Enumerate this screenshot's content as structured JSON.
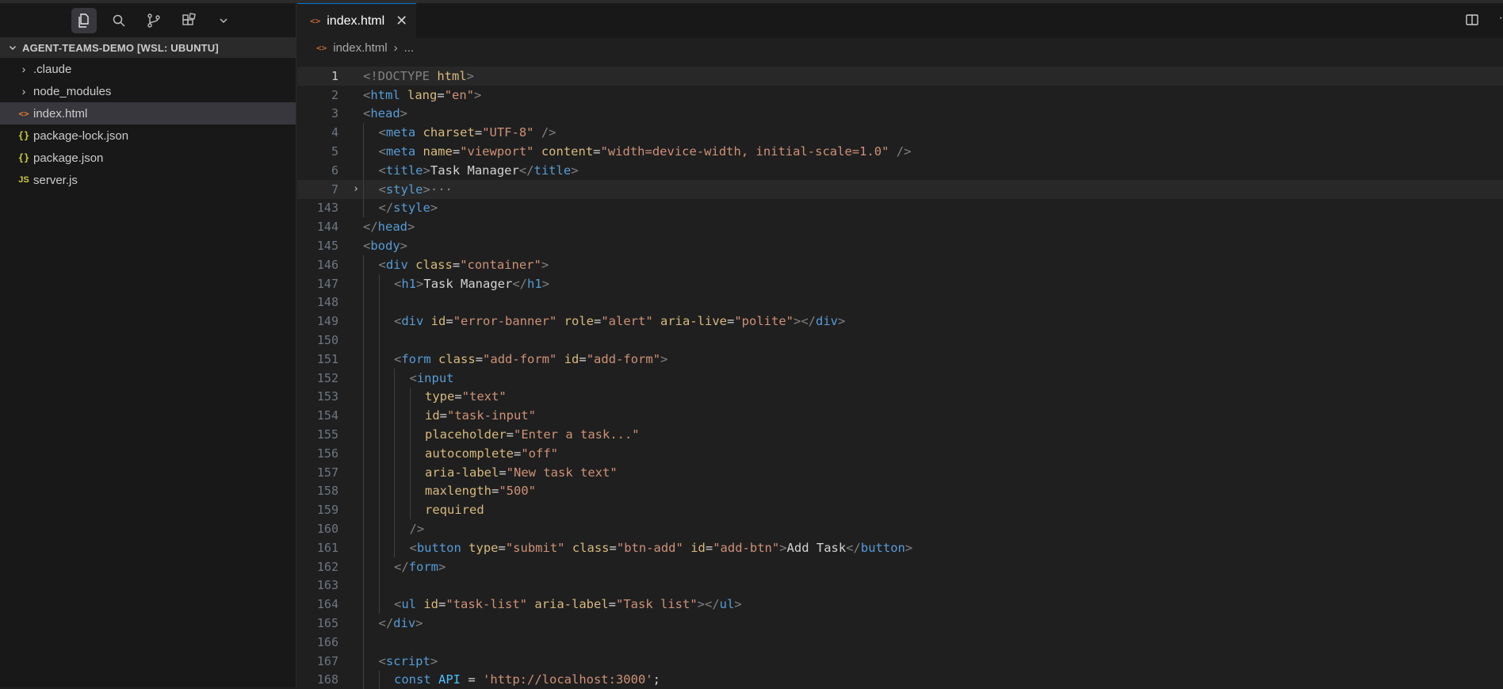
{
  "sidebar": {
    "project_title": "AGENT-TEAMS-DEMO [WSL: UBUNTU]",
    "items": [
      {
        "label": ".claude",
        "icon": "chevron-right-icon"
      },
      {
        "label": "node_modules",
        "icon": "chevron-right-icon"
      },
      {
        "label": "index.html",
        "icon": "<>"
      },
      {
        "label": "package-lock.json",
        "icon": "{}"
      },
      {
        "label": "package.json",
        "icon": "{}"
      },
      {
        "label": "server.js",
        "icon": "JS"
      }
    ]
  },
  "editor": {
    "tab_label": "index.html",
    "tab_icon": "<>",
    "breadcrumb_file": "index.html",
    "breadcrumb_more": "..."
  },
  "lines": [
    {
      "n": "1",
      "indent": 0,
      "fold": "",
      "tokens": [
        [
          "tag",
          "<!DOCTYPE "
        ],
        [
          "attr2",
          "html"
        ],
        [
          "tag",
          ">"
        ]
      ]
    },
    {
      "n": "2",
      "indent": 0,
      "fold": "",
      "tokens": [
        [
          "tag",
          "<"
        ],
        [
          "name",
          "html "
        ],
        [
          "attr2",
          "lang"
        ],
        [
          "text",
          "="
        ],
        [
          "str",
          "\"en\""
        ],
        [
          "tag",
          ">"
        ]
      ]
    },
    {
      "n": "3",
      "indent": 0,
      "fold": "",
      "tokens": [
        [
          "tag",
          "<"
        ],
        [
          "name",
          "head"
        ],
        [
          "tag",
          ">"
        ]
      ]
    },
    {
      "n": "4",
      "indent": 1,
      "fold": "",
      "tokens": [
        [
          "tag",
          "<"
        ],
        [
          "name",
          "meta "
        ],
        [
          "attr2",
          "charset"
        ],
        [
          "text",
          "="
        ],
        [
          "str",
          "\"UTF-8\""
        ],
        [
          "tag",
          " />"
        ]
      ]
    },
    {
      "n": "5",
      "indent": 1,
      "fold": "",
      "tokens": [
        [
          "tag",
          "<"
        ],
        [
          "name",
          "meta "
        ],
        [
          "attr2",
          "name"
        ],
        [
          "text",
          "="
        ],
        [
          "str",
          "\"viewport\" "
        ],
        [
          "attr2",
          "content"
        ],
        [
          "text",
          "="
        ],
        [
          "str",
          "\"width=device-width, initial-scale=1.0\""
        ],
        [
          "tag",
          " />"
        ]
      ]
    },
    {
      "n": "6",
      "indent": 1,
      "fold": "",
      "tokens": [
        [
          "tag",
          "<"
        ],
        [
          "name",
          "title"
        ],
        [
          "tag",
          ">"
        ],
        [
          "text",
          "Task Manager"
        ],
        [
          "tag",
          "</"
        ],
        [
          "name",
          "title"
        ],
        [
          "tag",
          ">"
        ]
      ]
    },
    {
      "n": "7",
      "indent": 1,
      "fold": "›",
      "tokens": [
        [
          "tag",
          "<"
        ],
        [
          "name",
          "style"
        ],
        [
          "tag",
          ">"
        ],
        [
          "dim",
          "···"
        ]
      ]
    },
    {
      "n": "143",
      "indent": 1,
      "fold": "",
      "tokens": [
        [
          "tag",
          "</"
        ],
        [
          "name",
          "style"
        ],
        [
          "tag",
          ">"
        ]
      ]
    },
    {
      "n": "144",
      "indent": 0,
      "fold": "",
      "tokens": [
        [
          "tag",
          "</"
        ],
        [
          "name",
          "head"
        ],
        [
          "tag",
          ">"
        ]
      ]
    },
    {
      "n": "145",
      "indent": 0,
      "fold": "",
      "tokens": [
        [
          "tag",
          "<"
        ],
        [
          "name",
          "body"
        ],
        [
          "tag",
          ">"
        ]
      ]
    },
    {
      "n": "146",
      "indent": 1,
      "fold": "",
      "tokens": [
        [
          "tag",
          "<"
        ],
        [
          "name",
          "div "
        ],
        [
          "attr2",
          "class"
        ],
        [
          "text",
          "="
        ],
        [
          "str",
          "\"container\""
        ],
        [
          "tag",
          ">"
        ]
      ]
    },
    {
      "n": "147",
      "indent": 2,
      "fold": "",
      "tokens": [
        [
          "tag",
          "<"
        ],
        [
          "name",
          "h1"
        ],
        [
          "tag",
          ">"
        ],
        [
          "text",
          "Task Manager"
        ],
        [
          "tag",
          "</"
        ],
        [
          "name",
          "h1"
        ],
        [
          "tag",
          ">"
        ]
      ]
    },
    {
      "n": "148",
      "indent": 2,
      "fold": "",
      "tokens": []
    },
    {
      "n": "149",
      "indent": 2,
      "fold": "",
      "tokens": [
        [
          "tag",
          "<"
        ],
        [
          "name",
          "div "
        ],
        [
          "attr2",
          "id"
        ],
        [
          "text",
          "="
        ],
        [
          "str",
          "\"error-banner\" "
        ],
        [
          "attr2",
          "role"
        ],
        [
          "text",
          "="
        ],
        [
          "str",
          "\"alert\" "
        ],
        [
          "attr2",
          "aria-live"
        ],
        [
          "text",
          "="
        ],
        [
          "str",
          "\"polite\""
        ],
        [
          "tag",
          "></"
        ],
        [
          "name",
          "div"
        ],
        [
          "tag",
          ">"
        ]
      ]
    },
    {
      "n": "150",
      "indent": 2,
      "fold": "",
      "tokens": []
    },
    {
      "n": "151",
      "indent": 2,
      "fold": "",
      "tokens": [
        [
          "tag",
          "<"
        ],
        [
          "name",
          "form "
        ],
        [
          "attr2",
          "class"
        ],
        [
          "text",
          "="
        ],
        [
          "str",
          "\"add-form\" "
        ],
        [
          "attr2",
          "id"
        ],
        [
          "text",
          "="
        ],
        [
          "str",
          "\"add-form\""
        ],
        [
          "tag",
          ">"
        ]
      ]
    },
    {
      "n": "152",
      "indent": 3,
      "fold": "",
      "tokens": [
        [
          "tag",
          "<"
        ],
        [
          "name",
          "input"
        ]
      ]
    },
    {
      "n": "153",
      "indent": 4,
      "fold": "",
      "tokens": [
        [
          "attr2",
          "type"
        ],
        [
          "text",
          "="
        ],
        [
          "str",
          "\"text\""
        ]
      ]
    },
    {
      "n": "154",
      "indent": 4,
      "fold": "",
      "tokens": [
        [
          "attr2",
          "id"
        ],
        [
          "text",
          "="
        ],
        [
          "str",
          "\"task-input\""
        ]
      ]
    },
    {
      "n": "155",
      "indent": 4,
      "fold": "",
      "tokens": [
        [
          "attr2",
          "placeholder"
        ],
        [
          "text",
          "="
        ],
        [
          "str",
          "\"Enter a task...\""
        ]
      ]
    },
    {
      "n": "156",
      "indent": 4,
      "fold": "",
      "tokens": [
        [
          "attr2",
          "autocomplete"
        ],
        [
          "text",
          "="
        ],
        [
          "str",
          "\"off\""
        ]
      ]
    },
    {
      "n": "157",
      "indent": 4,
      "fold": "",
      "tokens": [
        [
          "attr2",
          "aria-label"
        ],
        [
          "text",
          "="
        ],
        [
          "str",
          "\"New task text\""
        ]
      ]
    },
    {
      "n": "158",
      "indent": 4,
      "fold": "",
      "tokens": [
        [
          "attr2",
          "maxlength"
        ],
        [
          "text",
          "="
        ],
        [
          "str",
          "\"500\""
        ]
      ]
    },
    {
      "n": "159",
      "indent": 4,
      "fold": "",
      "tokens": [
        [
          "attr2",
          "required"
        ]
      ]
    },
    {
      "n": "160",
      "indent": 3,
      "fold": "",
      "tokens": [
        [
          "tag",
          "/>"
        ]
      ]
    },
    {
      "n": "161",
      "indent": 3,
      "fold": "",
      "tokens": [
        [
          "tag",
          "<"
        ],
        [
          "name",
          "button "
        ],
        [
          "attr2",
          "type"
        ],
        [
          "text",
          "="
        ],
        [
          "str",
          "\"submit\" "
        ],
        [
          "attr2",
          "class"
        ],
        [
          "text",
          "="
        ],
        [
          "str",
          "\"btn-add\" "
        ],
        [
          "attr2",
          "id"
        ],
        [
          "text",
          "="
        ],
        [
          "str",
          "\"add-btn\""
        ],
        [
          "tag",
          ">"
        ],
        [
          "text",
          "Add Task"
        ],
        [
          "tag",
          "</"
        ],
        [
          "name",
          "button"
        ],
        [
          "tag",
          ">"
        ]
      ]
    },
    {
      "n": "162",
      "indent": 2,
      "fold": "",
      "tokens": [
        [
          "tag",
          "</"
        ],
        [
          "name",
          "form"
        ],
        [
          "tag",
          ">"
        ]
      ]
    },
    {
      "n": "163",
      "indent": 2,
      "fold": "",
      "tokens": []
    },
    {
      "n": "164",
      "indent": 2,
      "fold": "",
      "tokens": [
        [
          "tag",
          "<"
        ],
        [
          "name",
          "ul "
        ],
        [
          "attr2",
          "id"
        ],
        [
          "text",
          "="
        ],
        [
          "str",
          "\"task-list\" "
        ],
        [
          "attr2",
          "aria-label"
        ],
        [
          "text",
          "="
        ],
        [
          "str",
          "\"Task list\""
        ],
        [
          "tag",
          "></"
        ],
        [
          "name",
          "ul"
        ],
        [
          "tag",
          ">"
        ]
      ]
    },
    {
      "n": "165",
      "indent": 1,
      "fold": "",
      "tokens": [
        [
          "tag",
          "</"
        ],
        [
          "name",
          "div"
        ],
        [
          "tag",
          ">"
        ]
      ]
    },
    {
      "n": "166",
      "indent": 1,
      "fold": "",
      "tokens": []
    },
    {
      "n": "167",
      "indent": 1,
      "fold": "",
      "tokens": [
        [
          "tag",
          "<"
        ],
        [
          "name",
          "script"
        ],
        [
          "tag",
          ">"
        ]
      ]
    },
    {
      "n": "168",
      "indent": 2,
      "fold": "",
      "tokens": [
        [
          "kw",
          "const "
        ],
        [
          "var",
          "API"
        ],
        [
          "text",
          " = "
        ],
        [
          "str",
          "'http://localhost:3000'"
        ],
        [
          "text",
          ";"
        ]
      ]
    }
  ]
}
